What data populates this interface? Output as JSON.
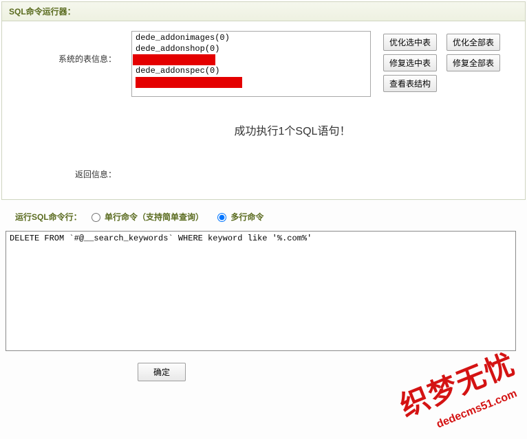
{
  "header": {
    "title": "SQL命令运行器："
  },
  "tableinfo": {
    "label": "系统的表信息：",
    "options": [
      "dede_addonimages(0)",
      "dede_addonshop(0)",
      "",
      "dede_addonspec(0)",
      ""
    ]
  },
  "buttons": {
    "opt_sel": "优化选中表",
    "opt_all": "优化全部表",
    "fix_sel": "修复选中表",
    "fix_all": "修复全部表",
    "view_struct": "查看表结构",
    "submit": "确定"
  },
  "success": "成功执行1个SQL语句！",
  "return_label": "返回信息：",
  "sql_runner": {
    "label": "运行SQL命令行：",
    "single": "单行命令（支持简单查询）",
    "multi": "多行命令"
  },
  "sql_text": "DELETE FROM `#@__search_keywords` WHERE keyword like '%.com%'",
  "watermark": {
    "cn": "织梦无忧",
    "en": "dedecms51.com"
  }
}
